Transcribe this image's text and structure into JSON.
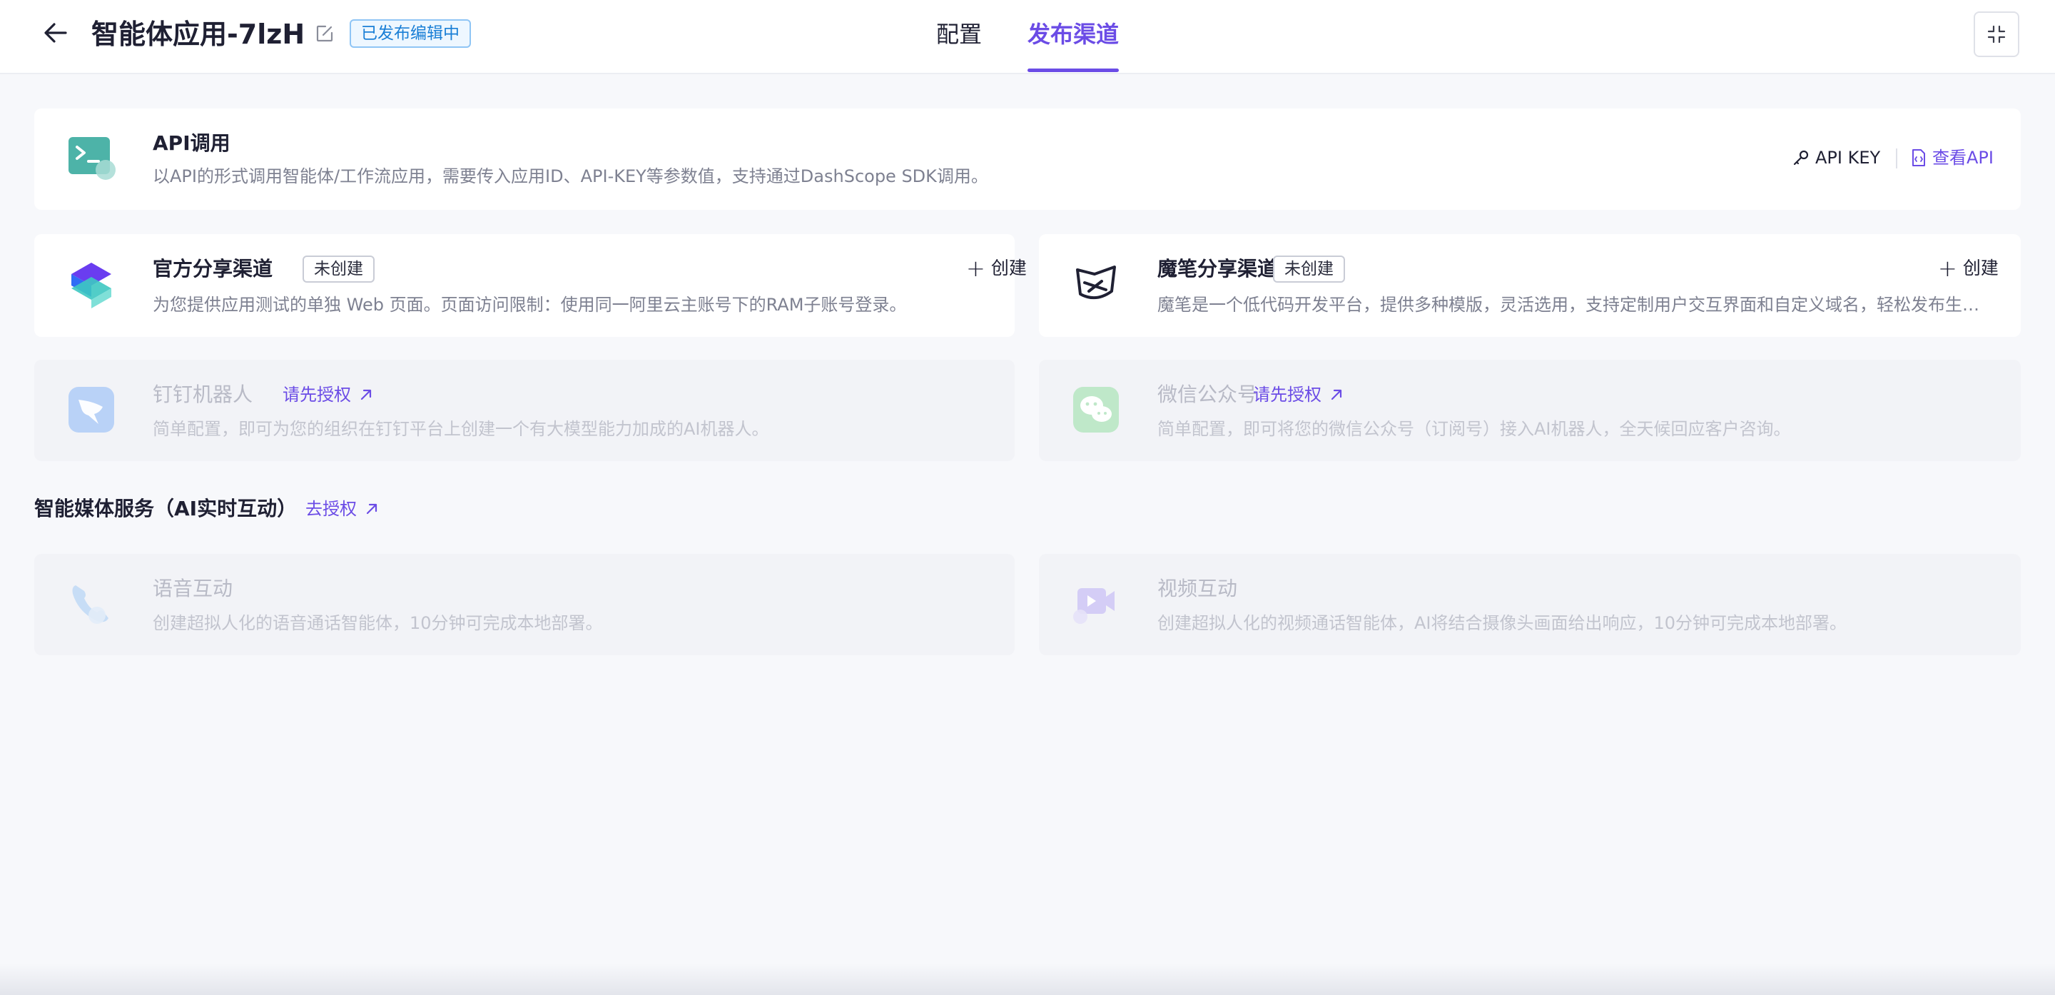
{
  "header": {
    "title": "智能体应用-7lzH",
    "status_badge": "已发布编辑中",
    "tabs": [
      {
        "label": "配置",
        "active": false
      },
      {
        "label": "发布渠道",
        "active": true
      }
    ]
  },
  "colors": {
    "accent": "#6b4ce6",
    "badge_blue": "#1a7fd6",
    "background": "#f7f8fb"
  },
  "api_card": {
    "title": "API调用",
    "desc": "以API的形式调用智能体/工作流应用，需要传入应用ID、API-KEY等参数值，支持通过DashScope SDK调用。",
    "api_key_label": "API KEY",
    "view_api_label": "查看API",
    "icon": "terminal-icon"
  },
  "official_card": {
    "title": "官方分享渠道",
    "tag": "未创建",
    "create_label": "创建",
    "desc": "为您提供应用测试的单独 Web 页面。页面访问限制：使用同一阿里云主账号下的RAM子账号登录。",
    "icon": "bailian-logo-icon"
  },
  "mobi_card": {
    "title": "魔笔分享渠道",
    "tag": "未创建",
    "create_label": "创建",
    "desc": "魔笔是一个低代码开发平台，提供多种模版，灵活选用，支持定制用户交互界面和自定义域名，轻松发布生产级...",
    "icon": "mobi-logo-icon"
  },
  "dingtalk_card": {
    "title": "钉钉机器人",
    "auth_label": "请先授权",
    "desc": "简单配置，即可为您的组织在钉钉平台上创建一个有大模型能力加成的AI机器人。",
    "icon": "dingtalk-icon"
  },
  "wechat_card": {
    "title": "微信公众号",
    "auth_label": "请先授权",
    "desc": "简单配置，即可将您的微信公众号（订阅号）接入AI机器人，全天候回应客户咨询。",
    "icon": "wechat-icon"
  },
  "media_section": {
    "title": "智能媒体服务（AI实时互动）",
    "auth_label": "去授权"
  },
  "voice_card": {
    "title": "语音互动",
    "desc": "创建超拟人化的语音通话智能体，10分钟可完成本地部署。",
    "icon": "phone-icon"
  },
  "video_card": {
    "title": "视频互动",
    "desc": "创建超拟人化的视频通话智能体，AI将结合摄像头画面给出响应，10分钟可完成本地部署。",
    "icon": "video-icon"
  }
}
